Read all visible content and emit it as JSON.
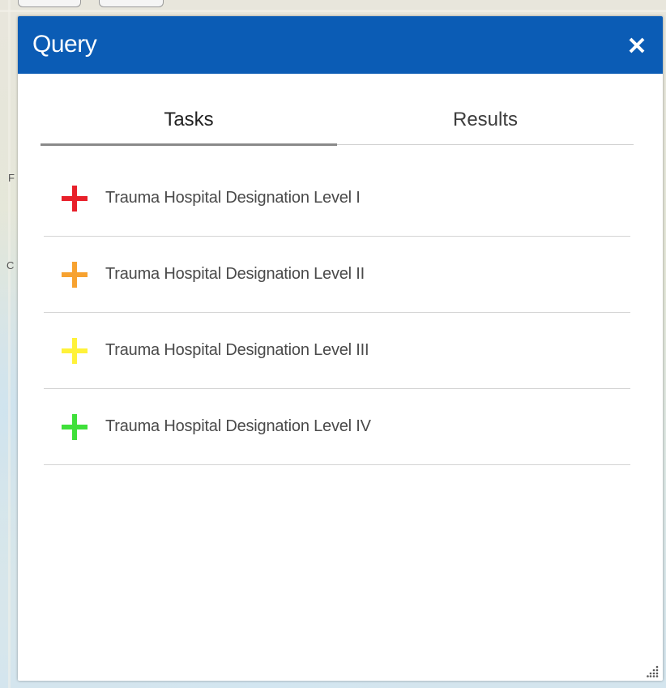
{
  "panel": {
    "title": "Query",
    "close_icon": "close-icon",
    "header_color": "#0b5cb5"
  },
  "tabs": [
    {
      "label": "Tasks",
      "active": true
    },
    {
      "label": "Results",
      "active": false
    }
  ],
  "tasks": [
    {
      "label": "Trauma Hospital Designation Level I",
      "icon": "plus-icon",
      "color": "#e8202a"
    },
    {
      "label": "Trauma Hospital Designation Level II",
      "icon": "plus-icon",
      "color": "#f7a230"
    },
    {
      "label": "Trauma Hospital Designation Level III",
      "icon": "plus-icon",
      "color": "#fff23a"
    },
    {
      "label": "Trauma Hospital Designation Level IV",
      "icon": "plus-icon",
      "color": "#3fe03a"
    }
  ],
  "map": {
    "edge_labels": [
      "F",
      "C"
    ]
  }
}
